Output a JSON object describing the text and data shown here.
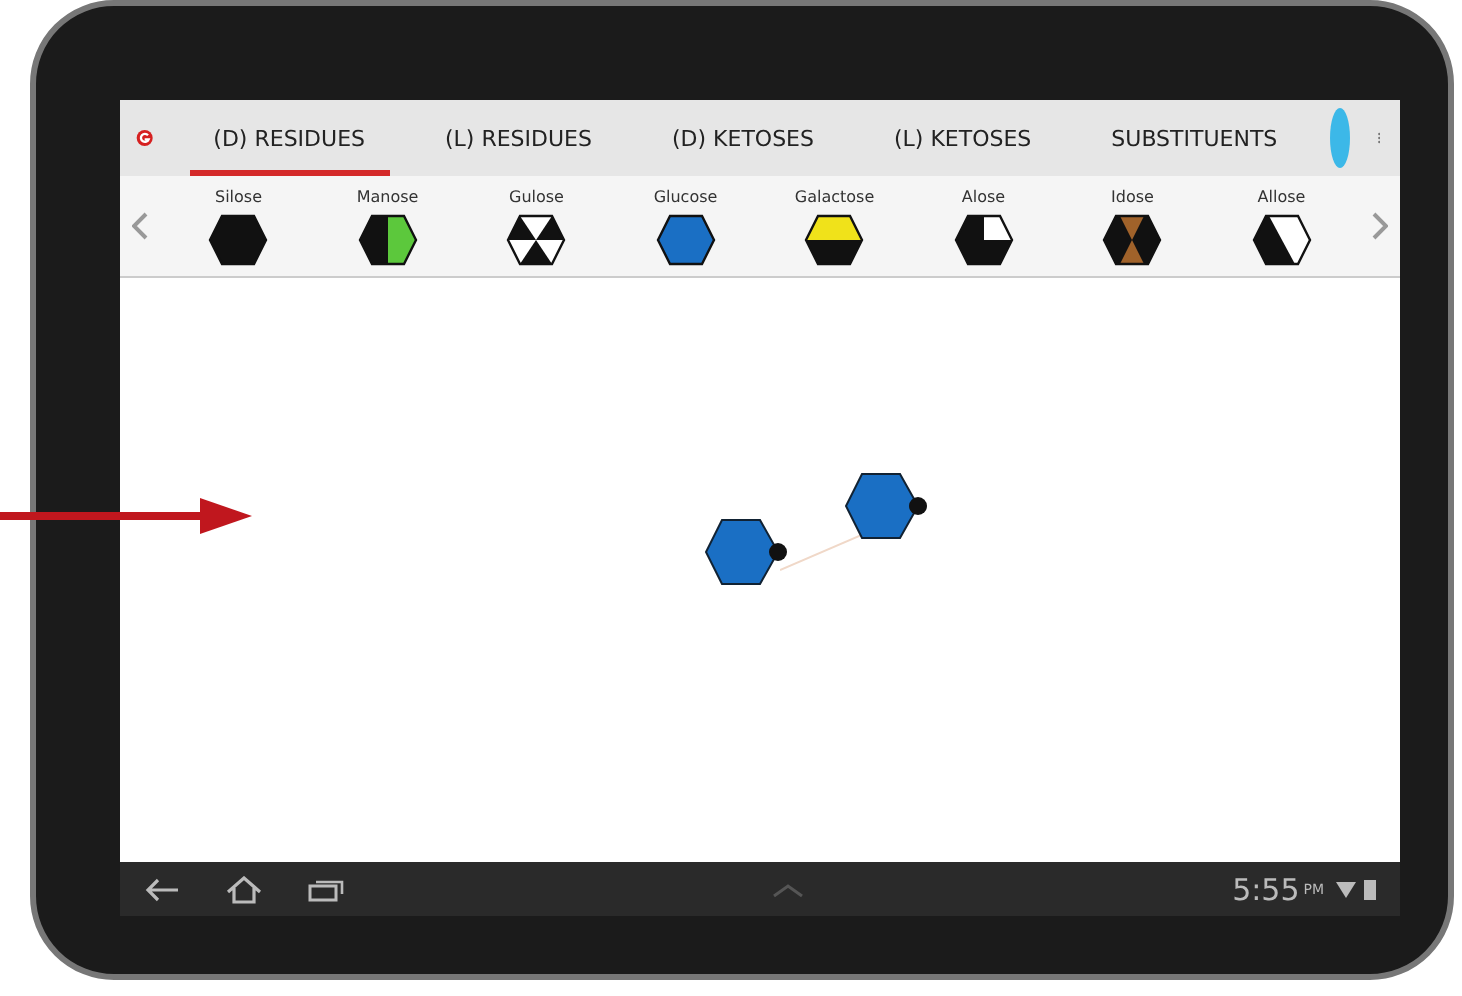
{
  "tabs": [
    {
      "label": "(D) RESIDUES",
      "selected": true
    },
    {
      "label": "(L) RESIDUES",
      "selected": false
    },
    {
      "label": "(D) KETOSES",
      "selected": false
    },
    {
      "label": "(L) KETOSES",
      "selected": false
    },
    {
      "label": "SUBSTITUENTS",
      "selected": false
    }
  ],
  "residues": [
    {
      "name": "Silose",
      "kind": "solid",
      "color": "#111111"
    },
    {
      "name": "Manose",
      "kind": "split",
      "color": "#5cc83c"
    },
    {
      "name": "Gulose",
      "kind": "triangles",
      "color": "#ffffff"
    },
    {
      "name": "Glucose",
      "kind": "solid",
      "color": "#1a6fc4"
    },
    {
      "name": "Galactose",
      "kind": "top",
      "color": "#f0e21a"
    },
    {
      "name": "Alose",
      "kind": "quarter",
      "color": "#ffffff"
    },
    {
      "name": "Idose",
      "kind": "hourglass",
      "color": "#a0622a"
    },
    {
      "name": "Allose",
      "kind": "diagonal",
      "color": "#ffffff"
    }
  ],
  "canvas": {
    "nodes": [
      {
        "color": "#1a6fc4"
      },
      {
        "color": "#1a6fc4"
      }
    ]
  },
  "status_bar": {
    "time": "5:55",
    "meridiem": "PM"
  }
}
